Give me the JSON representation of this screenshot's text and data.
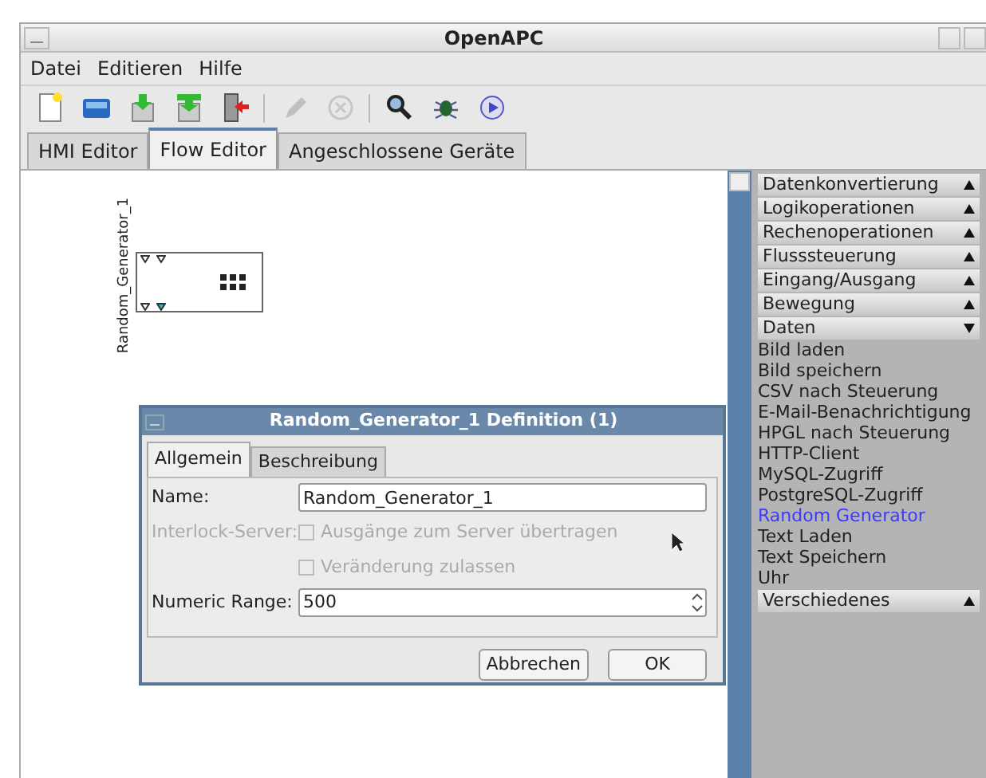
{
  "window": {
    "title": "OpenAPC"
  },
  "menu": [
    "Datei",
    "Editieren",
    "Hilfe"
  ],
  "toolbar": [
    {
      "kind": "new",
      "disabled": false
    },
    {
      "kind": "open",
      "disabled": false
    },
    {
      "kind": "save",
      "disabled": false
    },
    {
      "kind": "saveas",
      "disabled": false
    },
    {
      "kind": "exit",
      "disabled": false
    },
    {
      "kind": "sep"
    },
    {
      "kind": "edit",
      "disabled": true
    },
    {
      "kind": "cancel",
      "disabled": true
    },
    {
      "kind": "sep"
    },
    {
      "kind": "search",
      "disabled": false
    },
    {
      "kind": "debug",
      "disabled": false
    },
    {
      "kind": "play",
      "disabled": false
    }
  ],
  "tabs": [
    {
      "label": "HMI Editor",
      "selected": false
    },
    {
      "label": "Flow Editor",
      "selected": true
    },
    {
      "label": "Angeschlossene Geräte",
      "selected": false
    }
  ],
  "node": {
    "label": "Random_Generator_1"
  },
  "sidebar": [
    {
      "label": "Datenkonvertierung",
      "expanded": false
    },
    {
      "label": "Logikoperationen",
      "expanded": false
    },
    {
      "label": "Rechenoperationen",
      "expanded": false
    },
    {
      "label": "Flusssteuerung",
      "expanded": false
    },
    {
      "label": "Eingang/Ausgang",
      "expanded": false
    },
    {
      "label": "Bewegung",
      "expanded": false
    },
    {
      "label": "Daten",
      "expanded": true,
      "children": [
        {
          "label": "Bild laden",
          "selected": false
        },
        {
          "label": "Bild speichern",
          "selected": false
        },
        {
          "label": "CSV nach Steuerung",
          "selected": false
        },
        {
          "label": "E-Mail-Benachrichtigung",
          "selected": false
        },
        {
          "label": "HPGL nach Steuerung",
          "selected": false
        },
        {
          "label": "HTTP-Client",
          "selected": false
        },
        {
          "label": "MySQL-Zugriff",
          "selected": false
        },
        {
          "label": "PostgreSQL-Zugriff",
          "selected": false
        },
        {
          "label": "Random Generator",
          "selected": true
        },
        {
          "label": "Text Laden",
          "selected": false
        },
        {
          "label": "Text Speichern",
          "selected": false
        },
        {
          "label": "Uhr",
          "selected": false
        }
      ]
    },
    {
      "label": "Verschiedenes",
      "expanded": false
    }
  ],
  "dialog": {
    "title": "Random_Generator_1 Definition (1)",
    "tabs": [
      {
        "label": "Allgemein",
        "selected": true
      },
      {
        "label": "Beschreibung",
        "selected": false
      }
    ],
    "name_label": "Name:",
    "name_value": "Random_Generator_1",
    "interlock_label": "Interlock-Server:",
    "checks": [
      {
        "label": "Ausgänge zum Server übertragen",
        "checked": false,
        "disabled": true
      },
      {
        "label": "Veränderung zulassen",
        "checked": false,
        "disabled": true
      }
    ],
    "range_label": "Numeric Range:",
    "range_value": "500",
    "buttons": [
      "Abbrechen",
      "OK"
    ]
  }
}
